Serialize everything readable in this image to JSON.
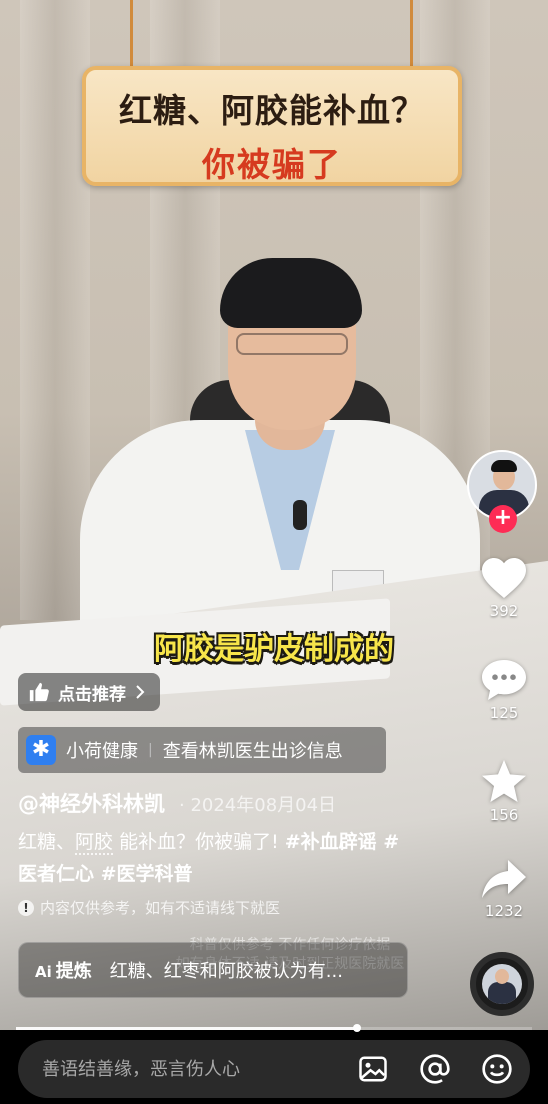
{
  "video": {
    "title_line1": "红糖、阿胶能补血？",
    "title_line2": "你被骗了",
    "subtitle": "阿胶是驴皮制成的",
    "watermark_line1": "科普仅供参考 不作任何诊疗依据",
    "watermark_line2": "如有身体不适 请及时到正规医院就医"
  },
  "rail": {
    "like_count": "392",
    "comment_count": "125",
    "favorite_count": "156",
    "share_count": "1232",
    "follow_symbol": "+"
  },
  "info": {
    "recommend_label": "点击推荐",
    "mini_app_name": "小荷健康",
    "mini_app_separator": "|",
    "mini_app_action": "查看林凯医生出诊信息",
    "author": "@神经外科林凯",
    "date": "· 2024年08月04日",
    "caption_text1": "红糖、",
    "caption_keyword": "阿胶",
    "caption_text2": " 能补血？你被骗了! ",
    "caption_tag1": "#补血辟谣",
    "caption_tag2": " #医者仁心",
    "caption_tag3": " #医学科普",
    "disclaimer": "内容仅供参考，如有不适请线下就医",
    "ai_label": "提炼",
    "ai_prefix": "Ai",
    "ai_summary": "红糖、红枣和阿胶被认为有..."
  },
  "progress": {
    "played_fraction": 0.66
  },
  "comment": {
    "placeholder": "善语结善缘，恶言伤人心"
  },
  "icons": [
    "thumbs-up-icon",
    "chevron-right-icon",
    "heart-icon",
    "comment-icon",
    "star-icon",
    "share-icon",
    "image-icon",
    "at-icon",
    "emoji-icon",
    "warning-icon"
  ]
}
